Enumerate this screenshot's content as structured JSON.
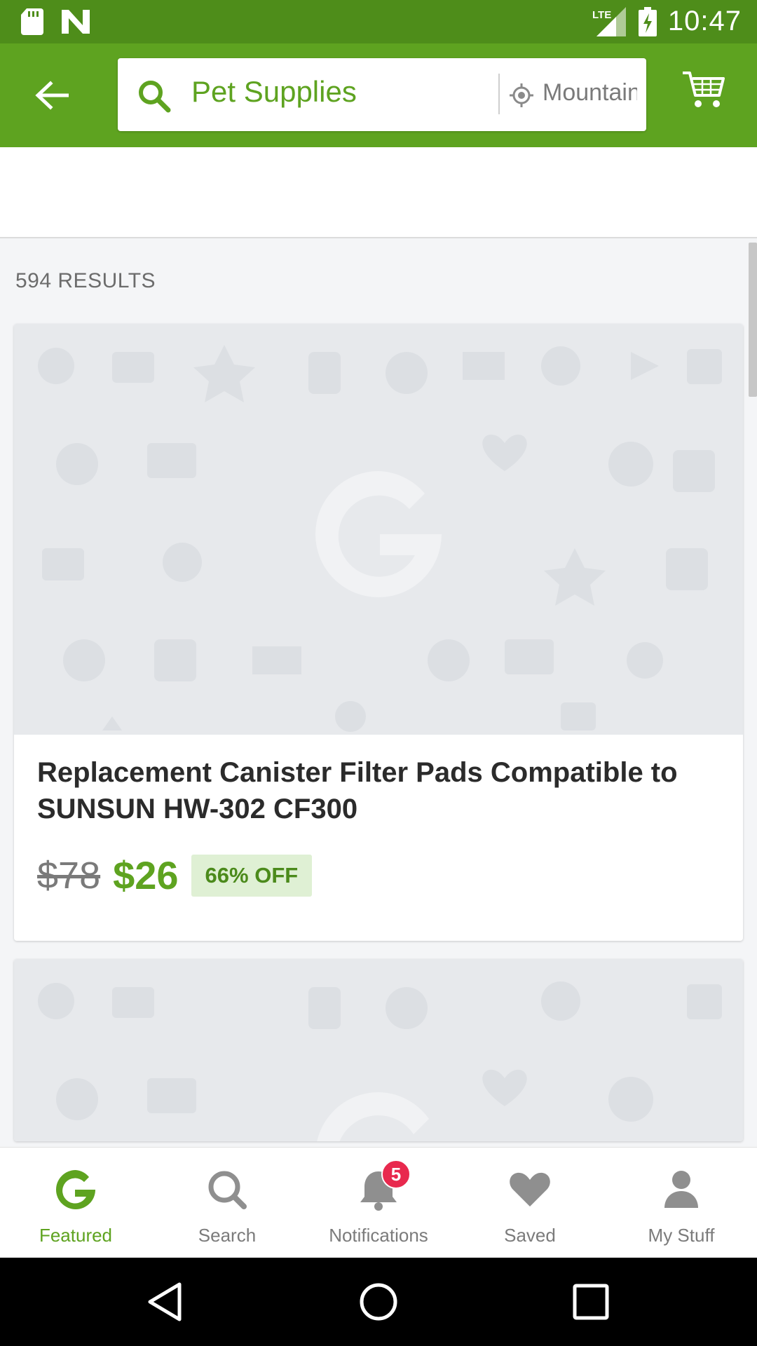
{
  "status_bar": {
    "time": "10:47",
    "network": "LTE",
    "icons": [
      "sd-card-icon",
      "n-icon",
      "signal-icon",
      "battery-charging-icon"
    ]
  },
  "header": {
    "back_icon": "arrow-left-icon",
    "search_query": "Pet Supplies",
    "location": "Mountain",
    "cart_icon": "cart-icon"
  },
  "results": {
    "count_label": "594 RESULTS"
  },
  "deals": [
    {
      "title": "Replacement Canister Filter Pads Compatible to SUNSUN HW-302 CF300",
      "old_price": "$78",
      "new_price": "$26",
      "discount": "66% OFF"
    }
  ],
  "bottom_nav": {
    "items": [
      {
        "label": "Featured",
        "icon": "groupon-g-icon",
        "active": true
      },
      {
        "label": "Search",
        "icon": "search-icon",
        "active": false
      },
      {
        "label": "Notifications",
        "icon": "bell-icon",
        "active": false
      },
      {
        "label": "Saved",
        "icon": "heart-icon",
        "active": false
      },
      {
        "label": "My Stuff",
        "icon": "person-icon",
        "active": false
      }
    ],
    "notifications_badge": "5"
  },
  "colors": {
    "brand_green": "#5ea320",
    "status_green": "#4e8d1a",
    "badge_red": "#e8294e"
  }
}
